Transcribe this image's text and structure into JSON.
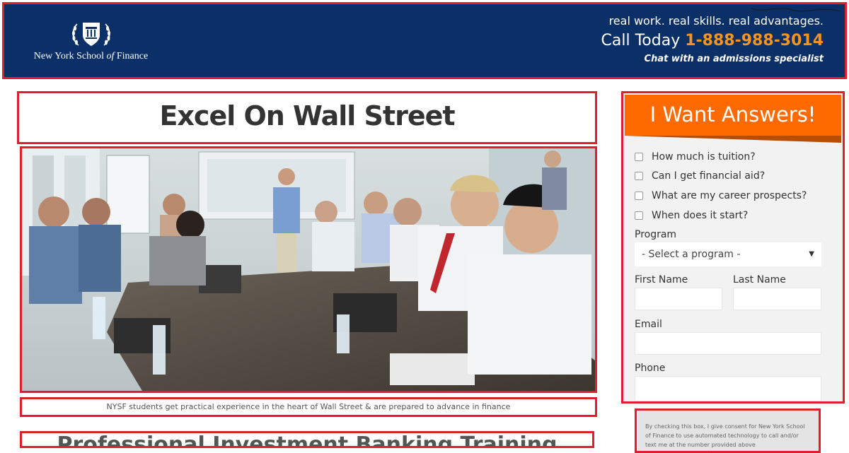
{
  "header": {
    "logo_text_prefix": "New York School",
    "logo_text_of": "of",
    "logo_text_suffix": "Finance",
    "tagline": "real work. real skills. real advantages.",
    "call_label": "Call Today",
    "phone": "1-888-988-3014",
    "chat": "Chat with an admissions specialist"
  },
  "main": {
    "headline": "Excel On Wall Street",
    "caption": "NYSF students get practical experience in the heart of Wall Street & are prepared to advance in finance",
    "subheadline": "Professional Investment Banking Training"
  },
  "form": {
    "title": "I Want Answers!",
    "questions": [
      "How much is tuition?",
      "Can I get financial aid?",
      "What are my career prospects?",
      "When does it start?"
    ],
    "program_label": "Program",
    "program_selected": "- Select a program -",
    "first_name_label": "First Name",
    "last_name_label": "Last Name",
    "email_label": "Email",
    "phone_label": "Phone",
    "consent": "By checking this box, I give consent for New York School of Finance to use automated technology to call and/or text me at the number provided above"
  },
  "colors": {
    "header_bg": "#0b2f67",
    "phone": "#f7941d",
    "form_banner": "#ff6a00",
    "highlight_border": "#e01e2d"
  }
}
